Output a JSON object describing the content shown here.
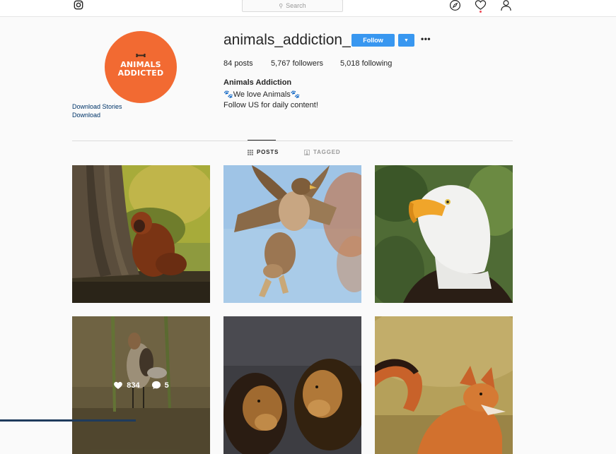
{
  "topbar": {
    "search_placeholder": "Search",
    "icons": [
      "instagram-icon",
      "compass-icon",
      "heart-icon",
      "user-icon"
    ]
  },
  "profile": {
    "username": "animals_addiction_",
    "follow_label": "Follow",
    "dropdown_symbol": "▼",
    "more_symbol": "•••",
    "avatar_text_line1": "ANIMALS",
    "avatar_text_line2": "ADDICTED",
    "download_stories": "Download Stories",
    "download": "Download",
    "stats": {
      "posts": "84",
      "posts_label": "posts",
      "followers": "5,767",
      "followers_label": "followers",
      "following": "5,018",
      "following_label": "following"
    },
    "full_name": "Animals Addiction",
    "bio_line1": "🐾We love Animals🐾",
    "bio_line2": "Follow US for daily content!"
  },
  "tabs": {
    "posts": "POSTS",
    "tagged": "TAGGED",
    "active": "posts"
  },
  "posts": [
    {
      "subject": "orangutan"
    },
    {
      "subject": "hawk"
    },
    {
      "subject": "bald-eagle"
    },
    {
      "subject": "bird",
      "likes": "834",
      "comments": "5"
    },
    {
      "subject": "lions"
    },
    {
      "subject": "fox"
    }
  ],
  "colors": {
    "accent": "#3897f0",
    "avatar": "#f26a32",
    "notification": "#ed4956"
  }
}
